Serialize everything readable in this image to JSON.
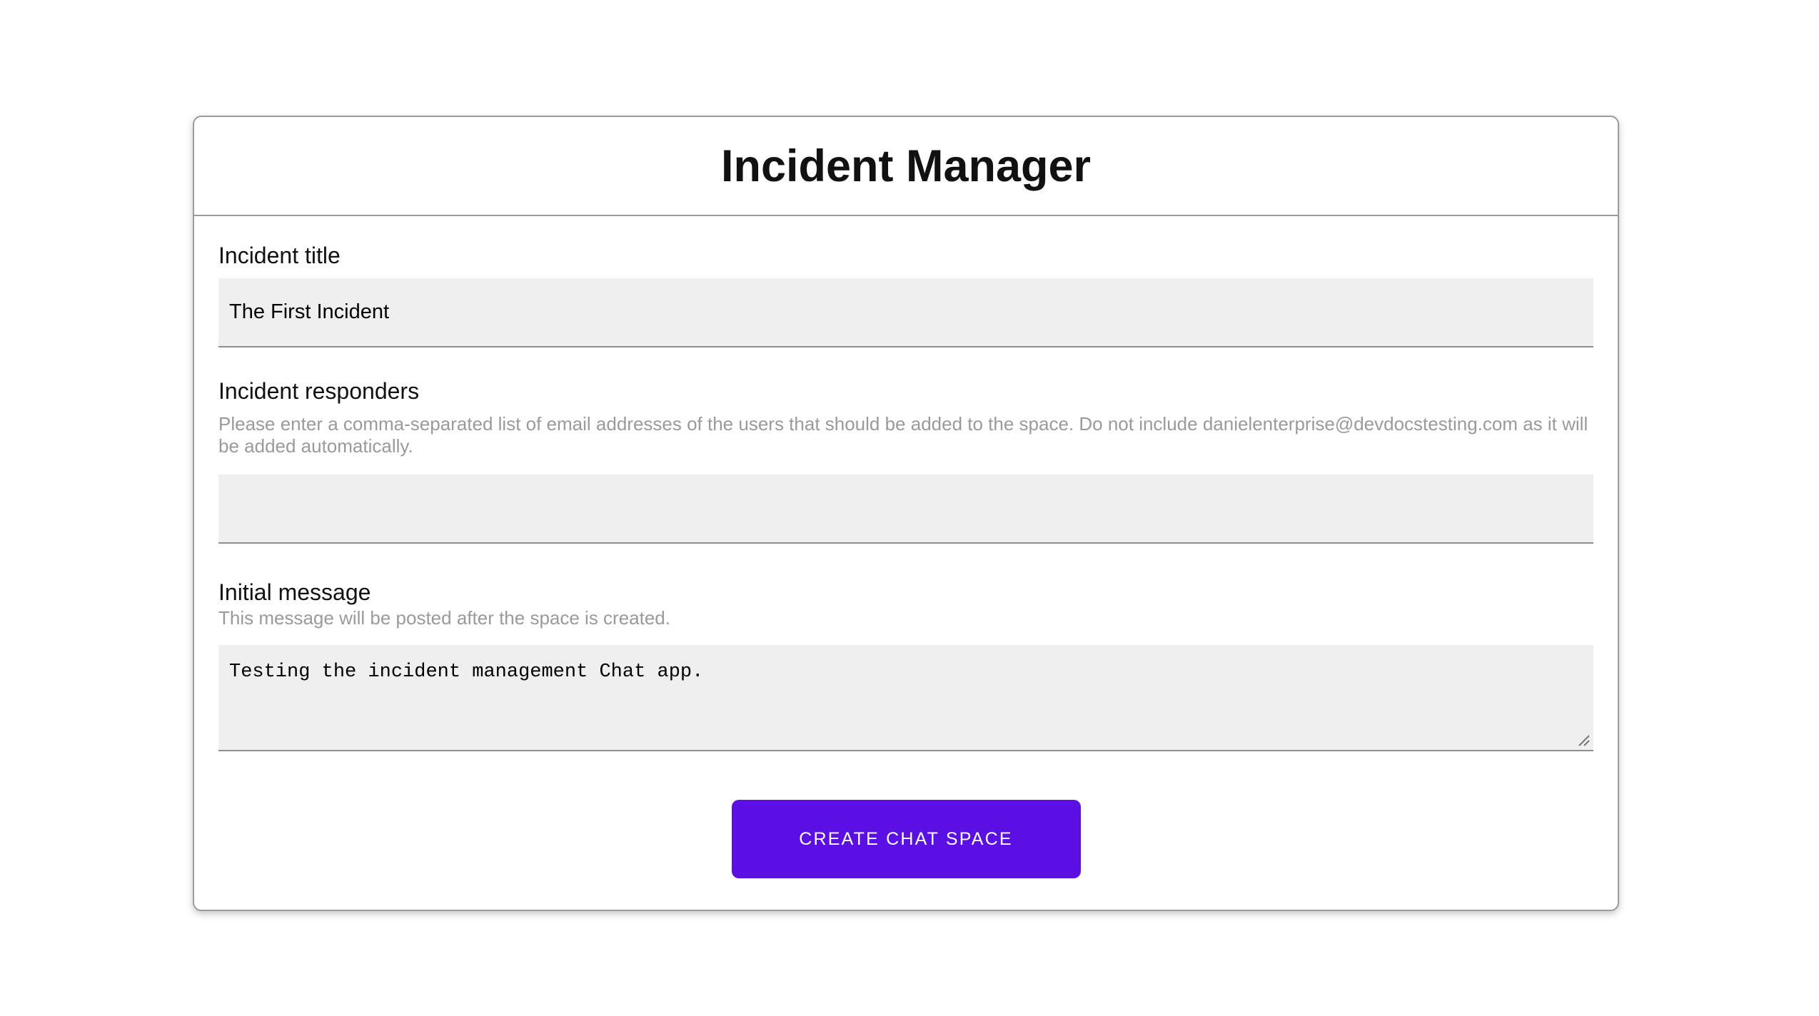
{
  "header": {
    "title": "Incident Manager"
  },
  "form": {
    "incident_title": {
      "label": "Incident title",
      "value": "The First Incident"
    },
    "incident_responders": {
      "label": "Incident responders",
      "helper": "Please enter a comma-separated list of email addresses of the users that should be added to the space. Do not include danielenterprise@devdocstesting.com as it will be added automatically.",
      "value": ""
    },
    "initial_message": {
      "label": "Initial message",
      "helper": "This message will be posted after the space is created.",
      "value": "Testing the incident management Chat app."
    }
  },
  "actions": {
    "create_button_label": "CREATE CHAT SPACE"
  },
  "colors": {
    "button_background": "#5B10E3",
    "button_text": "#ffffff",
    "input_background": "#efefef",
    "input_underline": "#909090",
    "helper_text": "#9a9a9a",
    "card_border": "#9b9b9b"
  }
}
